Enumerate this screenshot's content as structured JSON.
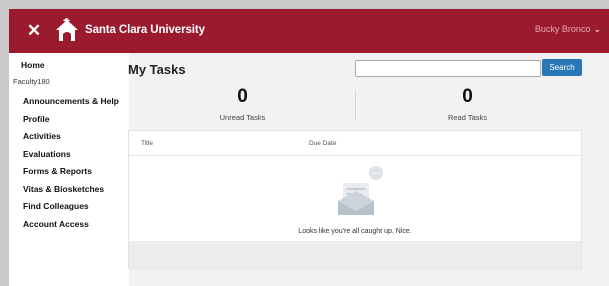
{
  "header": {
    "brand": "Santa Clara University",
    "user_name": "Bucky Bronco",
    "close_glyph": "✕",
    "chevron_glyph": "❯"
  },
  "sidebar": {
    "home": "Home",
    "subtitle": "Faculty180",
    "items": [
      {
        "label": "Announcements & Help"
      },
      {
        "label": "Profile"
      },
      {
        "label": "Activities"
      },
      {
        "label": "Evaluations"
      },
      {
        "label": "Forms & Reports"
      },
      {
        "label": "Vitas & Biosketches"
      },
      {
        "label": "Find Colleagues"
      },
      {
        "label": "Account Access"
      }
    ]
  },
  "main": {
    "title": "My Tasks",
    "search": {
      "value": "",
      "placeholder": "",
      "button_label": "Search"
    },
    "stats": {
      "unread": {
        "count": "0",
        "label": "Unread Tasks"
      },
      "read": {
        "count": "0",
        "label": "Read Tasks"
      }
    },
    "table": {
      "columns": [
        "Title",
        "Due Date"
      ],
      "empty_message": "Looks like you're all caught up. Nice."
    }
  },
  "colors": {
    "header_bg": "#9b1b2e",
    "accent": "#2a77b8"
  },
  "icons": [
    "close-icon",
    "santa-clara-logo-icon",
    "chevron-down-icon",
    "empty-inbox-icon"
  ]
}
